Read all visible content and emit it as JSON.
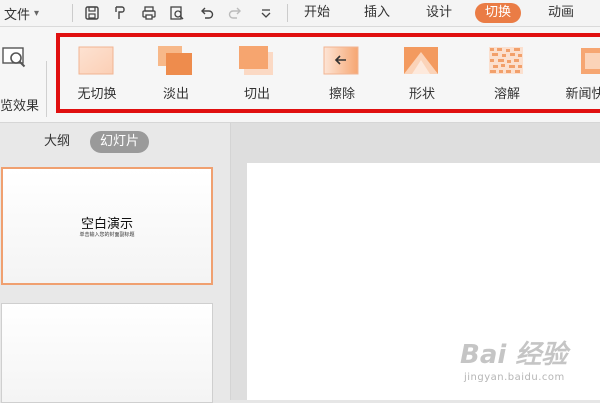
{
  "menubar": {
    "file": "文件",
    "tabs": [
      {
        "label": "开始",
        "active": false
      },
      {
        "label": "插入",
        "active": false
      },
      {
        "label": "设计",
        "active": false
      },
      {
        "label": "切换",
        "active": true
      },
      {
        "label": "动画",
        "active": false
      }
    ],
    "quick_access_icons": [
      "save-icon",
      "format-painter-icon",
      "print-icon",
      "print-preview-icon",
      "undo-icon",
      "redo-icon",
      "customize-dropdown-icon"
    ]
  },
  "ribbon": {
    "preview_label": "览效果",
    "effects": [
      {
        "label": "无切换",
        "icon": "no-transition-icon"
      },
      {
        "label": "淡出",
        "icon": "fade-icon"
      },
      {
        "label": "切出",
        "icon": "cut-icon"
      },
      {
        "label": "擦除",
        "icon": "wipe-icon"
      },
      {
        "label": "形状",
        "icon": "shape-icon"
      },
      {
        "label": "溶解",
        "icon": "dissolve-icon"
      },
      {
        "label": "新闻快",
        "icon": "newsflash-icon"
      }
    ]
  },
  "side_panel": {
    "tabs": [
      {
        "label": "大纲",
        "active": false
      },
      {
        "label": "幻灯片",
        "active": true
      }
    ],
    "slides": [
      {
        "title": "空白演示",
        "subtitle": "单击输入您的封面副标题"
      }
    ]
  },
  "watermark": {
    "main": "Bai 经验",
    "sub": "jingyan.baidu.com"
  },
  "colors": {
    "accent": "#ea7c45",
    "highlight": "#e01010"
  }
}
